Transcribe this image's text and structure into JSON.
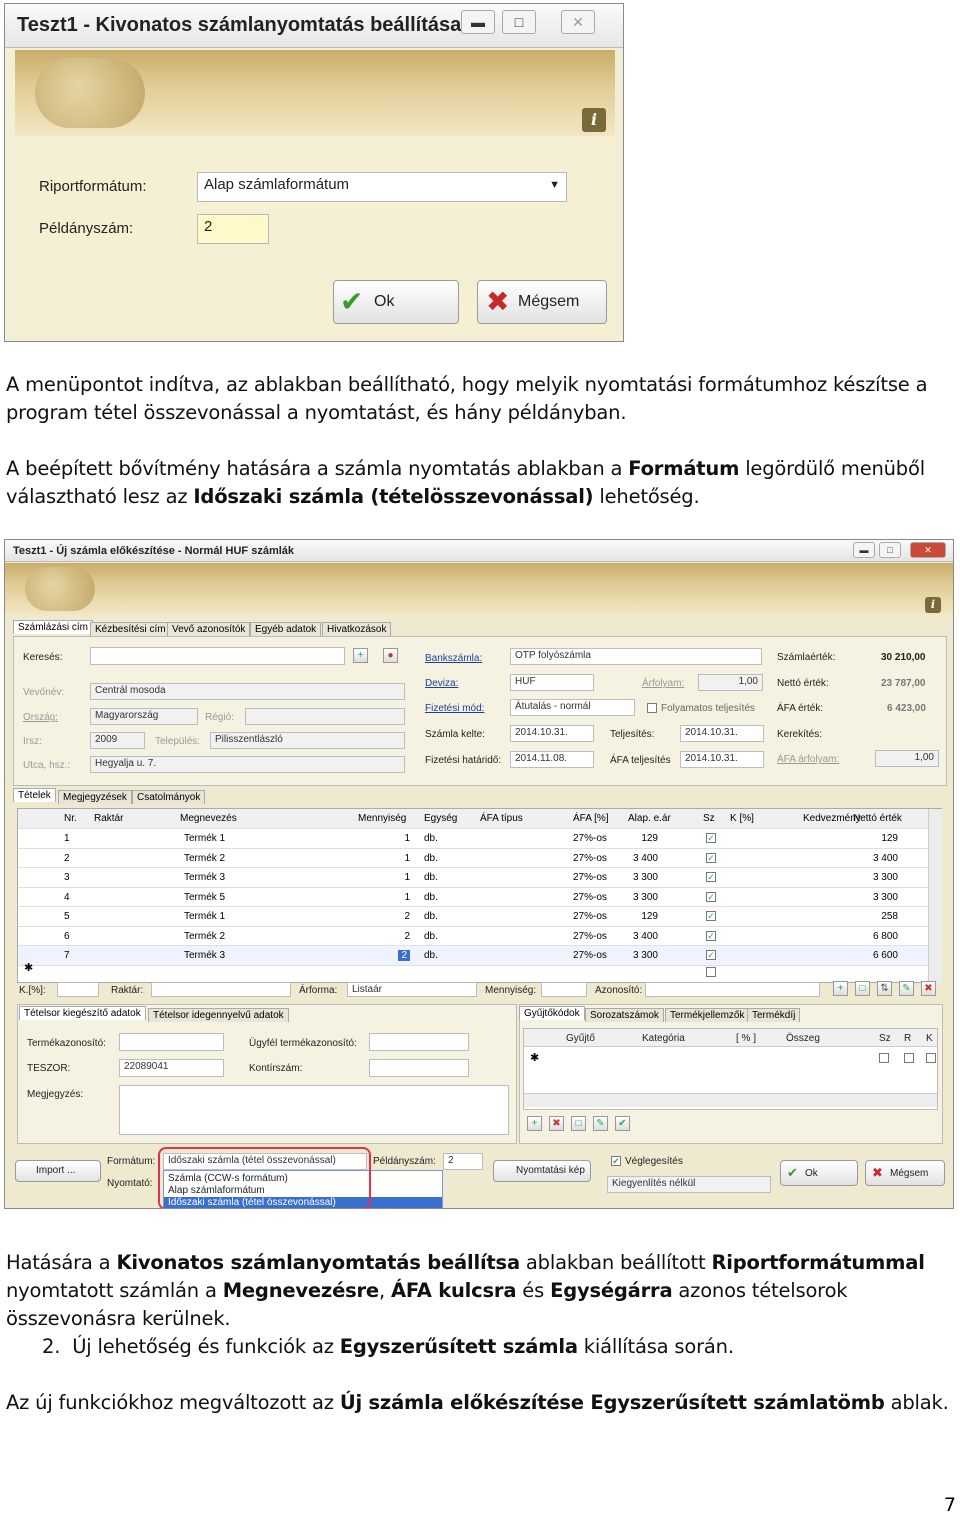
{
  "win1": {
    "title": "Teszt1 - Kivonatos számlanyomtatás beállítása",
    "fields": [
      {
        "label": "Riportformátum:",
        "value": "Alap számlaformátum"
      },
      {
        "label": "Példányszám:",
        "value": "2"
      }
    ],
    "ok": "Ok",
    "cancel": "Mégsem",
    "info": "i"
  },
  "para1": "A menüpontot indítva, az ablakban beállítható, hogy melyik nyomtatási formátumhoz készítse a program tétel összevonással a nyomtatást, és hány példányban.",
  "para2": {
    "a": "A beépített bővítmény hatására a számla nyomtatás ablakban a ",
    "b": "Formátum",
    "c": " legördülő menüből választható lesz az ",
    "d": "Időszaki számla (tételösszevonással)",
    "e": " lehetőség."
  },
  "win2": {
    "title": "Teszt1 - Új számla előkészítése - Normál HUF számlák",
    "tabs": [
      "Számlázási cím",
      "Kézbesítési cím",
      "Vevő azonosítók",
      "Egyéb adatok",
      "Hivatkozások"
    ],
    "kereses": "Keresés:",
    "left": [
      {
        "label": "Vevőnév:",
        "value": "Centrál mosoda"
      },
      {
        "label": "Ország:",
        "value": "Magyarország",
        "label2": "Régió:"
      },
      {
        "label": "Irsz:",
        "value": "2009",
        "label2": "Település:",
        "value2": "Pilisszentlászló"
      },
      {
        "label": "Utca, hsz.:",
        "value": "Hegyalja u. 7."
      }
    ],
    "mid": [
      {
        "label": "Bankszámla:",
        "value": "OTP folyószámla"
      },
      {
        "label": "Deviza:",
        "value": "HUF",
        "label2": "Árfolyam:",
        "value2": "1,00"
      },
      {
        "label": "Fizetési mód:",
        "value": "Átutalás - normál",
        "check": "Folyamatos teljesítés"
      },
      {
        "label": "Számla kelte:",
        "value": "2014.10.31.",
        "label2": "Teljesítés:",
        "value2": "2014.10.31."
      },
      {
        "label": "Fizetési határidő:",
        "value": "2014.11.08.",
        "label2": "ÁFA teljesítés",
        "value2": "2014.10.31."
      }
    ],
    "right": [
      {
        "label": "Számlaérték:",
        "value": "30 210,00"
      },
      {
        "label": "Nettó érték:",
        "value": "23 787,00"
      },
      {
        "label": "ÁFA érték:",
        "value": "6 423,00"
      },
      {
        "label": "Kerekítés:",
        "value": ""
      },
      {
        "label": "ÁFA árfolyam:",
        "value": "1,00"
      }
    ],
    "subtabs": [
      "Tételek",
      "Megjegyzések",
      "Csatolmányok"
    ],
    "cols": [
      "Nr.",
      "Raktár",
      "Megnevezés",
      "Mennyiség",
      "Egység",
      "ÁFA típus",
      "ÁFA [%]",
      "Alap. e.ár",
      "Sz",
      "K [%]",
      "Kedvezmény",
      "Nettó érték"
    ],
    "rows": [
      [
        "1",
        "",
        "Termék 1",
        "1",
        "db.",
        "",
        "27%-os",
        "129",
        "✓",
        "",
        "",
        "129"
      ],
      [
        "2",
        "",
        "Termék 2",
        "1",
        "db.",
        "",
        "27%-os",
        "3 400",
        "✓",
        "",
        "",
        "3 400"
      ],
      [
        "3",
        "",
        "Termék 3",
        "1",
        "db.",
        "",
        "27%-os",
        "3 300",
        "✓",
        "",
        "",
        "3 300"
      ],
      [
        "4",
        "",
        "Termék 5",
        "1",
        "db.",
        "",
        "27%-os",
        "3 300",
        "✓",
        "",
        "",
        "3 300"
      ],
      [
        "5",
        "",
        "Termék 1",
        "2",
        "db.",
        "",
        "27%-os",
        "129",
        "✓",
        "",
        "",
        "258"
      ],
      [
        "6",
        "",
        "Termék 2",
        "2",
        "db.",
        "",
        "27%-os",
        "3 400",
        "✓",
        "",
        "",
        "6 800"
      ],
      [
        "7",
        "",
        "Termék 3",
        "2",
        "db.",
        "",
        "27%-os",
        "3 300",
        "✓",
        "",
        "",
        "6 600"
      ]
    ],
    "filter": [
      "K.[%]:",
      "Raktár:",
      "Árforma:",
      "Listaár",
      "Mennyiség:",
      "Azonosító:"
    ],
    "lowtabs": [
      "Tételsor kiegészítő adatok",
      "Tételsor idegennyelvű adatok"
    ],
    "lowfields": [
      "Termékazonosító:",
      "Ügyfél termékazonosító:",
      "TESZOR:",
      "22089041",
      "Kontírszám:",
      "Megjegyzés:"
    ],
    "rtabs": [
      "Gyűjtőkódok",
      "Sorozatszámok",
      "Termékjellemzők",
      "Termékdíj"
    ],
    "rcols": [
      "Gyűjtő",
      "Kategória",
      "[ % ]",
      "Összeg",
      "Sz",
      "R",
      "K"
    ],
    "bottom": {
      "import": "Import ...",
      "format_label": "Formátum:",
      "format_value": "Időszaki számla (tétel összevonással)",
      "printer": "Nyomtató:",
      "copies_label": "Példányszám:",
      "copies": "2",
      "preview": "Nyomtatási kép",
      "final": "Véglegesítés",
      "send": "Kiegyenlítés nélkül",
      "ok": "Ok",
      "cancel": "Mégsem"
    },
    "dropdown": [
      "Számla (CCW-s formátum)",
      "Alap számlaformátum",
      "Időszaki számla (tétel összevonással)"
    ]
  },
  "para3": {
    "a": "Hatására a ",
    "b": "Kivonatos számlanyomtatás beállítsa",
    "c": " ablakban beállított ",
    "d": "Riportformátummal",
    "e": " nyomtatott számlán a ",
    "f": "Megnevezésre",
    "g": ", ",
    "h": "ÁFA kulcsra",
    "i": " és ",
    "j": "Egységárra",
    "k": " azonos tételsorok összevonásra kerülnek."
  },
  "para4": {
    "num": "2.",
    "a": "Új lehetőség és funkciók az ",
    "b": "Egyszerűsített számla",
    "c": " kiállítása során."
  },
  "para5": {
    "a": "Az új funkciókhoz megváltozott az ",
    "b": "Új számla előkészítése Egyszerűsített számlatömb",
    "c": " ablak."
  },
  "page_number": "7"
}
